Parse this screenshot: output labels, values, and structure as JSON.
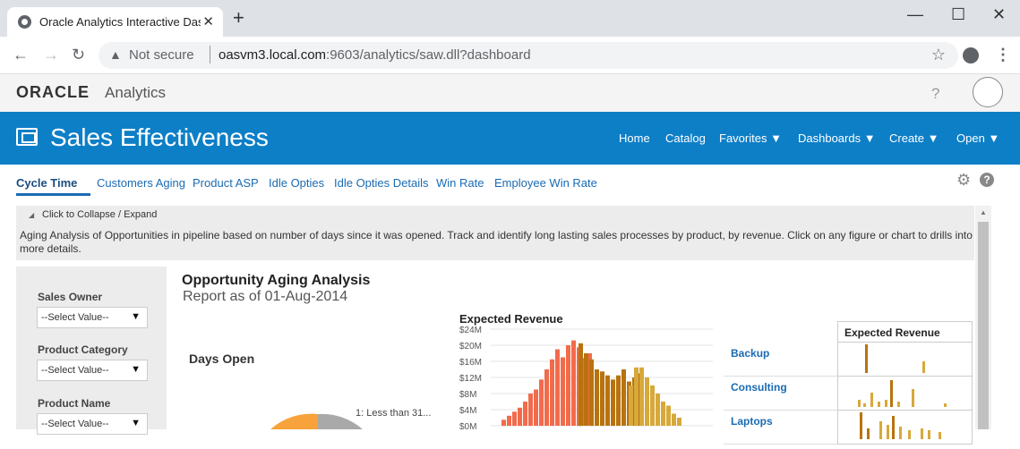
{
  "browser": {
    "tab_title": "Oracle Analytics Interactive Dashb",
    "tab_close": "✕",
    "new_tab": "+",
    "window_min": "—",
    "window_max": "☐",
    "window_close": "✕",
    "back": "←",
    "forward": "→",
    "reload": "↻",
    "security_label": "Not secure",
    "url_host": "oasvm3.local.com",
    "url_rest": ":9603/analytics/saw.dll?dashboard",
    "bookmark": "☆",
    "menu": "⋮"
  },
  "oracle_header": {
    "logo": "ORACLE",
    "product": "Analytics",
    "help": "?"
  },
  "dashboard": {
    "title": "Sales Effectiveness",
    "nav": [
      "Home",
      "Catalog",
      "Favorites ▼",
      "Dashboards ▼",
      "Create ▼",
      "Open ▼"
    ]
  },
  "page_tabs": {
    "items": [
      "Cycle Time",
      "Customers Aging",
      "Product ASP",
      "Idle Opties",
      "Idle Opties Details",
      "Win Rate",
      "Employee Win Rate"
    ],
    "active": "Cycle Time",
    "settings_icon": "⚙",
    "help_icon": "?"
  },
  "section": {
    "collapse_label": "Click to Collapse / Expand",
    "description": "Aging Analysis of Opportunities in pipeline based on number of days since it was opened. Track and identify long lasting sales processes by product, by revenue. Click on any figure or chart to drills into more details."
  },
  "prompts": {
    "items": [
      {
        "label": "Sales Owner",
        "value": "--Select Value--"
      },
      {
        "label": "Product Category",
        "value": "--Select Value--"
      },
      {
        "label": "Product Name",
        "value": "--Select Value--"
      }
    ]
  },
  "report": {
    "title": "Opportunity Aging Analysis",
    "subtitle": "Report as of 01-Aug-2014",
    "pie_title": "Days Open",
    "pie_label": "1: Less than 31...",
    "pivot_header": "Expected Revenue",
    "pivot_rows": [
      "Backup",
      "Consulting",
      "Laptops"
    ]
  },
  "chart_data": {
    "type": "bar",
    "title": "Expected Revenue",
    "xlabel": "",
    "ylabel": "",
    "ylim": [
      0,
      24
    ],
    "ytick_labels": [
      "$24M",
      "$20M",
      "$16M",
      "$12M",
      "$8M",
      "$4M",
      "$0M"
    ],
    "y_unit": "M",
    "series": [
      {
        "color": "#f26b4b",
        "values": [
          1.5,
          2.5,
          3.5,
          4.5,
          6,
          8,
          9,
          11.5,
          14,
          16.5,
          19,
          17,
          20,
          21.2,
          19.5,
          16.8,
          18
        ]
      },
      {
        "color": "#b8730f",
        "values": [
          20.5,
          18,
          16.5,
          14,
          13.5,
          12.5,
          11.5,
          12.5,
          14,
          11,
          12,
          13
        ]
      },
      {
        "color": "#d7a93a",
        "values": [
          10,
          14.5,
          14.5,
          12,
          10,
          8,
          6,
          5,
          3,
          2
        ]
      }
    ],
    "colors": {
      "series1": "#f26b4b",
      "series2": "#b8730f",
      "series3": "#d7a93a"
    }
  },
  "colors": {
    "brand_blue": "#0d7fc7",
    "link": "#1a6bb3"
  }
}
